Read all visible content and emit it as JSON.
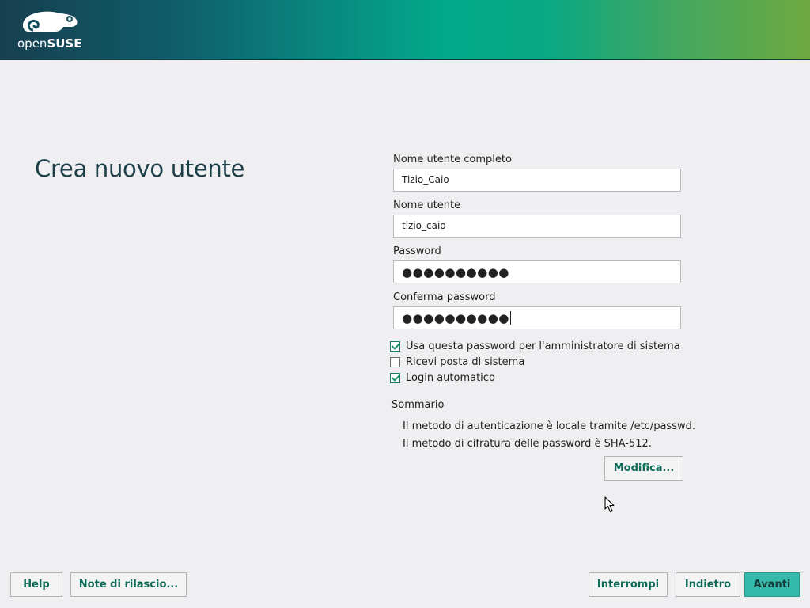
{
  "header": {
    "logo_text_light": "open",
    "logo_text_bold": "SUSE"
  },
  "page": {
    "title": "Crea nuovo utente"
  },
  "form": {
    "full_name_label": "Nome utente completo",
    "full_name_value": "Tizio_Caio",
    "username_label": "Nome utente",
    "username_value": "tizio_caio",
    "password_label": "Password",
    "password_value": "●●●●●●●●●●",
    "confirm_label": "Conferma password",
    "confirm_value": "●●●●●●●●●●"
  },
  "options": [
    {
      "label": "Usa questa password per l'amministratore di sistema",
      "checked": true
    },
    {
      "label": "Ricevi posta di sistema",
      "checked": false
    },
    {
      "label": "Login automatico",
      "checked": true
    }
  ],
  "summary": {
    "heading": "Sommario",
    "lines": [
      "Il metodo di autenticazione è locale tramite /etc/passwd.",
      "Il metodo di cifratura delle password è SHA-512."
    ],
    "modify_button": "Modifica..."
  },
  "footer": {
    "help": "Help",
    "release_notes": "Note di rilascio...",
    "abort": "Interrompi",
    "back": "Indietro",
    "next": "Avanti"
  },
  "colors": {
    "accent": "#35b9ab",
    "link_text": "#0d6b57",
    "title": "#1d3f49"
  }
}
